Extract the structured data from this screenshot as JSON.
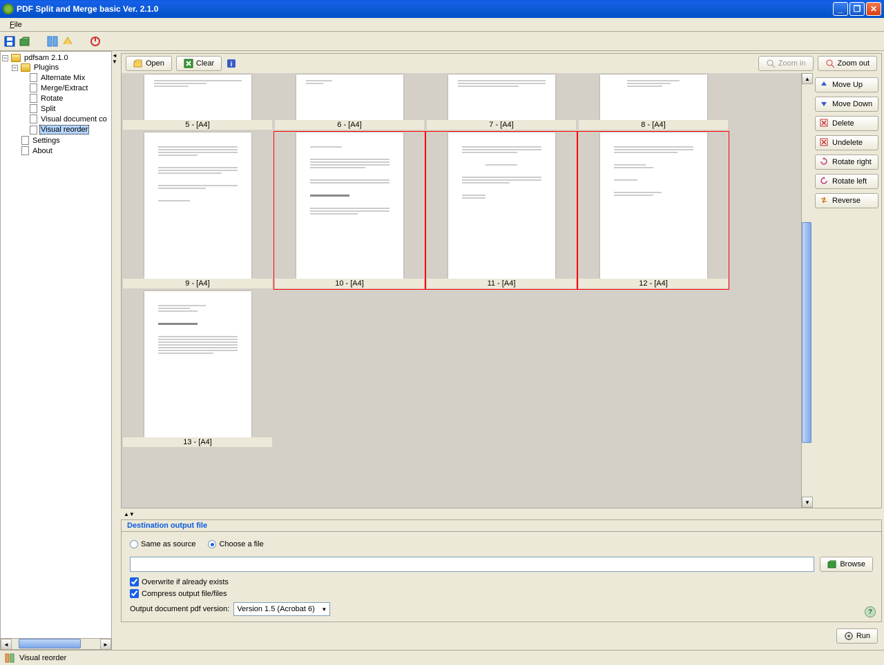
{
  "window": {
    "title": "PDF Split and Merge basic Ver. 2.1.0"
  },
  "menu": {
    "file": "File"
  },
  "tree": {
    "root": "pdfsam 2.1.0",
    "plugins": "Plugins",
    "items": [
      "Alternate Mix",
      "Merge/Extract",
      "Rotate",
      "Split",
      "Visual document co",
      "Visual reorder"
    ],
    "settings": "Settings",
    "about": "About"
  },
  "toolbar": {
    "open": "Open",
    "clear": "Clear",
    "zoom_in": "Zoom in",
    "zoom_out": "Zoom out"
  },
  "right_buttons": {
    "move_up": "Move Up",
    "move_down": "Move Down",
    "delete": "Delete",
    "undelete": "Undelete",
    "rotate_right": "Rotate right",
    "rotate_left": "Rotate left",
    "reverse": "Reverse"
  },
  "thumbs": [
    {
      "label": "5 - [A4]",
      "sel": false
    },
    {
      "label": "6 - [A4]",
      "sel": false
    },
    {
      "label": "7 - [A4]",
      "sel": false
    },
    {
      "label": "8 - [A4]",
      "sel": false
    },
    {
      "label": "9 - [A4]",
      "sel": false
    },
    {
      "label": "10 - [A4]",
      "sel": true
    },
    {
      "label": "11 - [A4]",
      "sel": true
    },
    {
      "label": "12 - [A4]",
      "sel": true
    },
    {
      "label": "13 - [A4]",
      "sel": false
    }
  ],
  "output": {
    "title": "Destination output file",
    "same_as_source": "Same as source",
    "choose_file": "Choose a file",
    "browse": "Browse",
    "overwrite": "Overwrite if already exists",
    "compress": "Compress output file/files",
    "version_label": "Output document pdf version:",
    "version_value": "Version 1.5 (Acrobat 6)"
  },
  "run": "Run",
  "status": "Visual reorder"
}
